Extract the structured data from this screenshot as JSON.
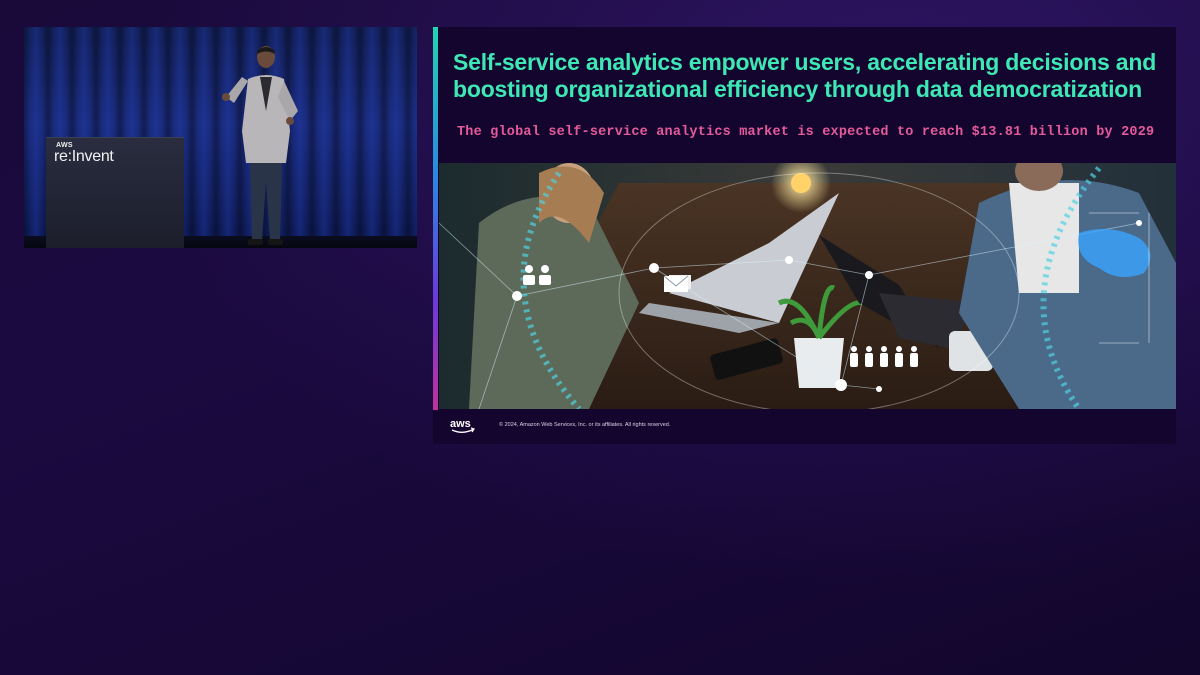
{
  "speaker_panel": {
    "podium_logo_small": "AWS",
    "podium_logo_main": "re:Invent"
  },
  "slide": {
    "title_line1": "Self-service analytics empower users, accelerating decisions and",
    "title_line2": "boosting organizational efficiency through data democratization",
    "subtitle": "The global self-service analytics market is expected to reach $13.81 billion by 2029",
    "footer": {
      "logo": "aws",
      "copyright": "© 2024, Amazon Web Services, Inc. or its affiliates. All rights reserved."
    }
  },
  "colors": {
    "background": "#1a0a3a",
    "title": "#3ee8b5",
    "subtitle": "#e45a9a",
    "accent_top": "#21d6b0",
    "accent_bottom": "#d72f8c"
  }
}
